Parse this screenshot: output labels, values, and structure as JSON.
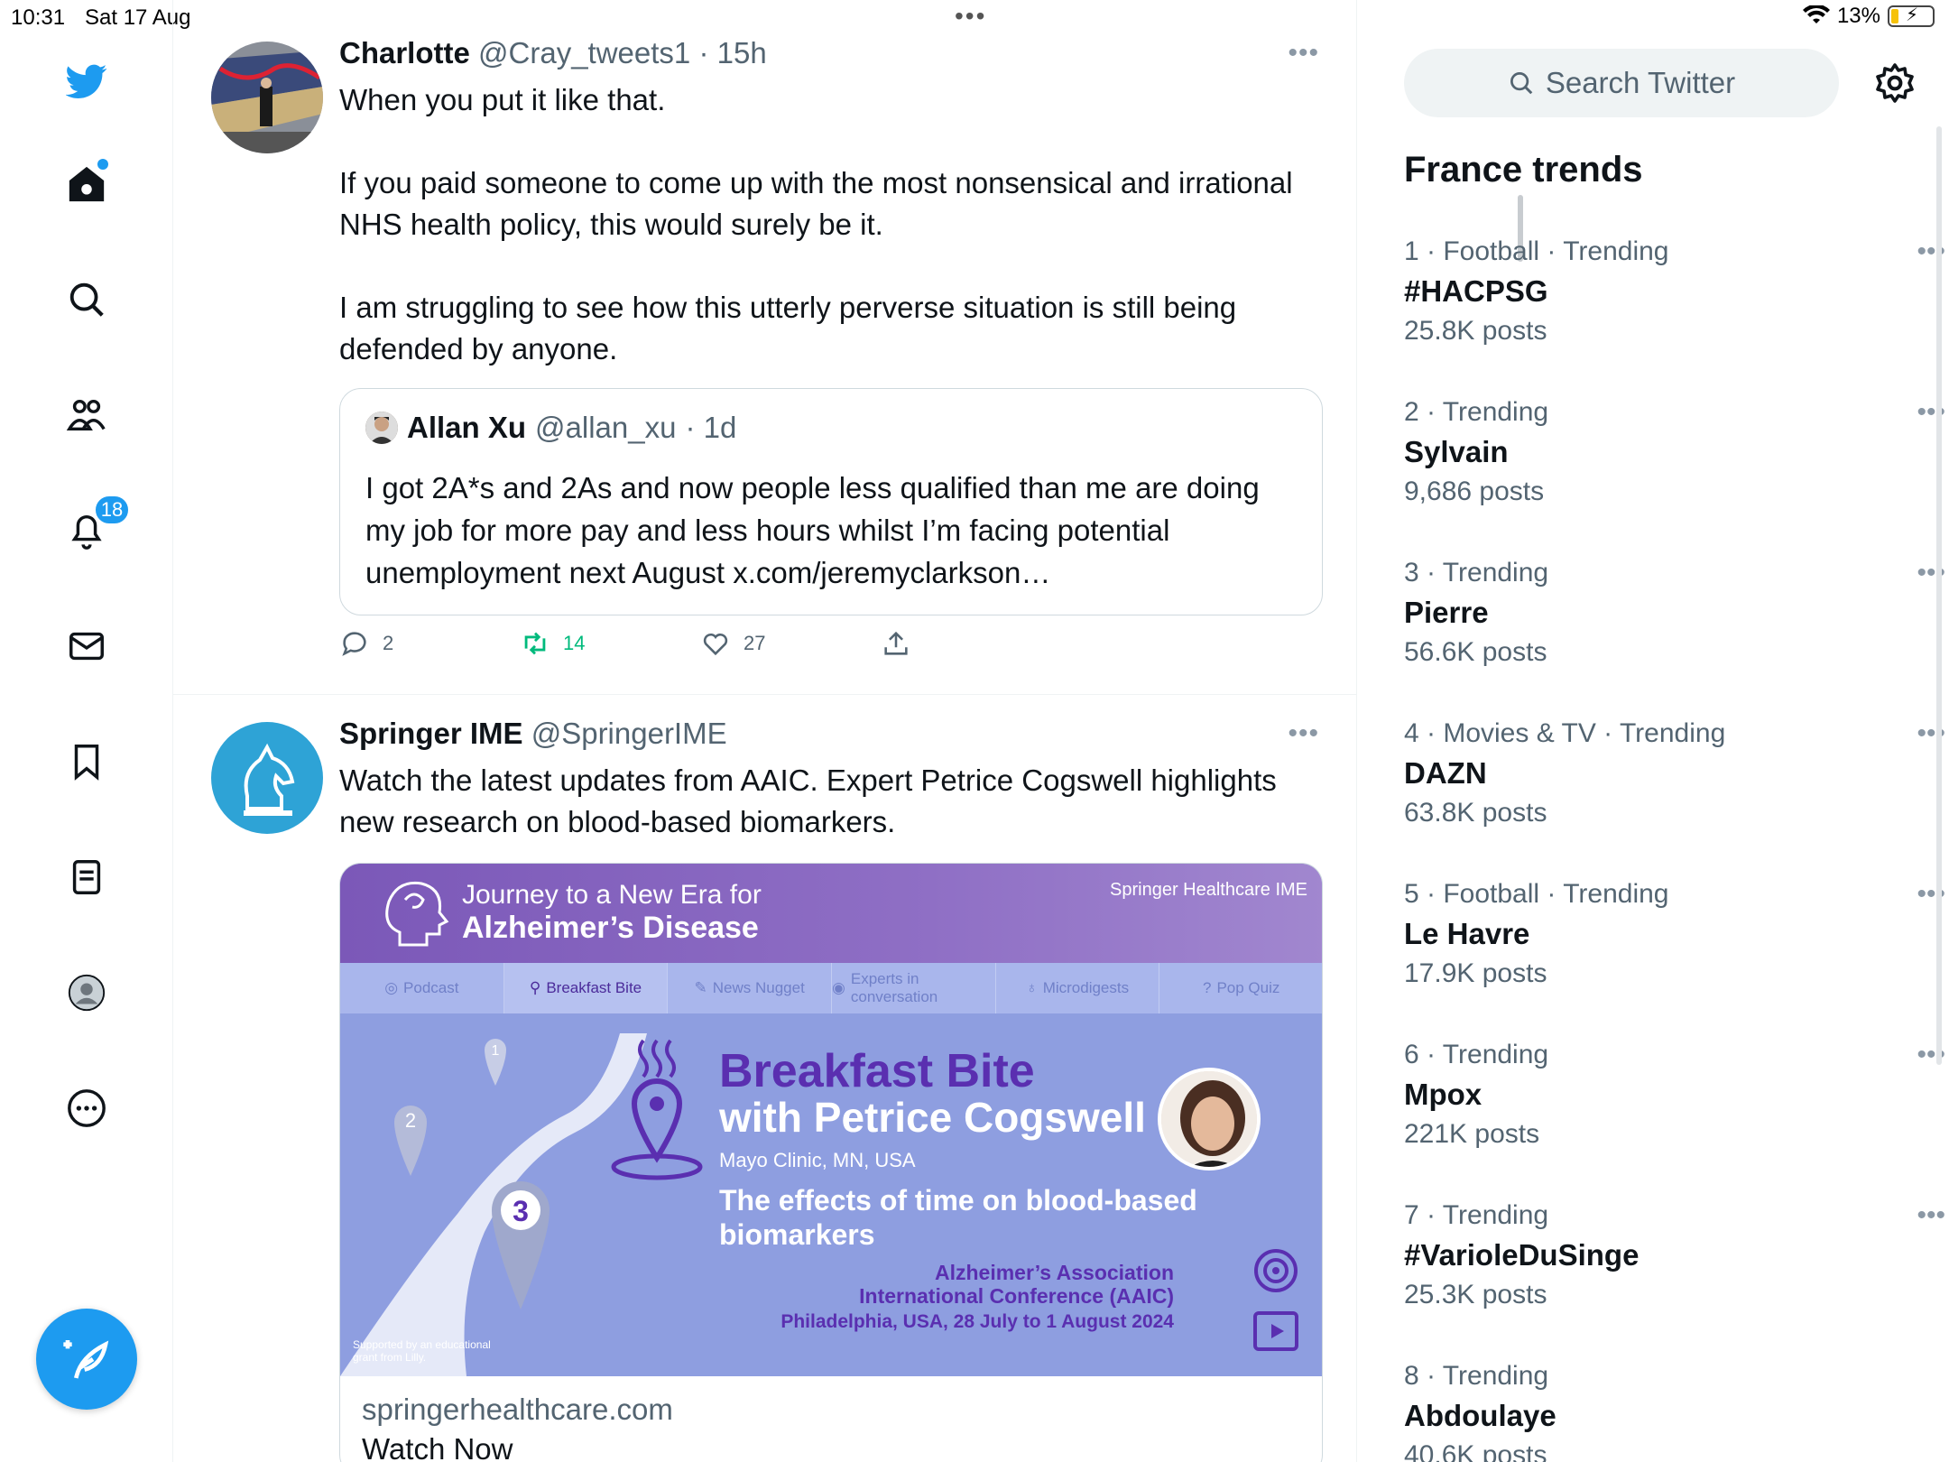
{
  "status_bar": {
    "time": "10:31",
    "date": "Sat 17 Aug",
    "battery": "13%"
  },
  "nav": {
    "notifications_count": "18"
  },
  "tweets": [
    {
      "name": "Charlotte",
      "handle": "@Cray_tweets1",
      "time": "· 15h",
      "text": "When you put it like that.\n\nIf you paid someone to come up with the most nonsensical and irrational NHS health policy, this would surely be it.\n\nI am struggling to see how this utterly perverse situation is still being defended by anyone.",
      "quote": {
        "name": "Allan Xu",
        "handle": "@allan_xu",
        "time": "· 1d",
        "text": "I got 2A*s and 2As and now people less qualified than me are doing my job for more pay and less hours whilst I’m facing potential unemployment next August x.com/jeremyclarkson…"
      },
      "replies": "2",
      "retweets": "14",
      "likes": "27"
    },
    {
      "name": "Springer IME",
      "handle": "@SpringerIME",
      "text": "Watch the latest updates from AAIC. Expert Petrice Cogswell highlights new research on blood-based biomarkers.",
      "media": {
        "title_line1": "Journey to a New Era for",
        "title_line2": "Alzheimer’s Disease",
        "brand": "Springer Healthcare IME",
        "tabs": [
          "Podcast",
          "Breakfast Bite",
          "News Nugget",
          "Experts in conversation",
          "Microdigests",
          "Pop Quiz"
        ],
        "heading": "Breakfast Bite",
        "subheading": "with Petrice Cogswell",
        "affiliation": "Mayo Clinic, MN, USA",
        "topic": "The effects of time on blood-based biomarkers",
        "conference1": "Alzheimer’s Association",
        "conference2": "International Conference (AAIC)",
        "conference3": "Philadelphia, USA, 28 July to 1 August 2024",
        "support": "Supported by an educational grant from Lilly.",
        "steps": [
          "1",
          "2",
          "3"
        ]
      },
      "card_domain": "springerhealthcare.com",
      "card_title": "Watch Now"
    }
  ],
  "search": {
    "placeholder": "Search Twitter"
  },
  "trends": {
    "title": "France trends",
    "items": [
      {
        "meta": "1 · Football · Trending",
        "topic": "#HACPSG",
        "count": "25.8K posts"
      },
      {
        "meta": "2 · Trending",
        "topic": "Sylvain",
        "count": "9,686 posts"
      },
      {
        "meta": "3 · Trending",
        "topic": "Pierre",
        "count": "56.6K posts"
      },
      {
        "meta": "4 · Movies & TV · Trending",
        "topic": "DAZN",
        "count": "63.8K posts"
      },
      {
        "meta": "5 · Football · Trending",
        "topic": "Le Havre",
        "count": "17.9K posts"
      },
      {
        "meta": "6 · Trending",
        "topic": "Mpox",
        "count": "221K posts"
      },
      {
        "meta": "7 · Trending",
        "topic": "#VarioleDuSinge",
        "count": "25.3K posts"
      },
      {
        "meta": "8 · Trending",
        "topic": "Abdoulaye",
        "count": "40.6K posts"
      }
    ]
  },
  "colors": {
    "accent": "#1d9bf0",
    "retweet": "#00ba7c",
    "muted": "#536471"
  }
}
